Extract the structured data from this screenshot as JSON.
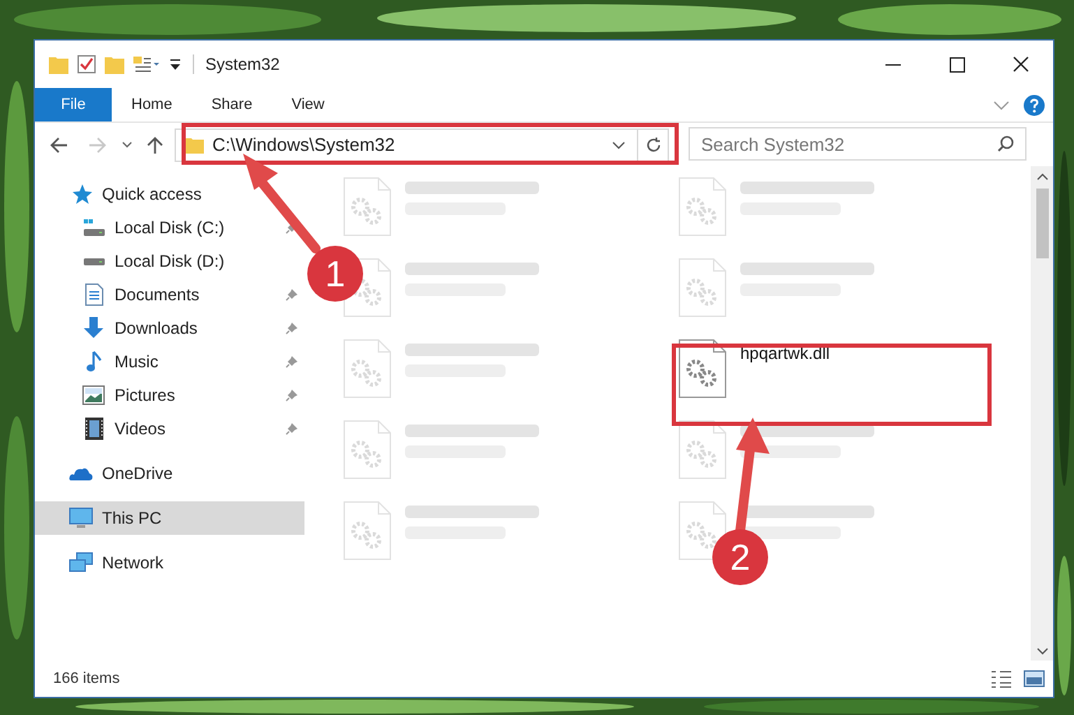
{
  "window": {
    "title": "System32"
  },
  "ribbon_tabs": [
    {
      "label": "File",
      "kind": "file",
      "selected": false
    },
    {
      "label": "Home",
      "kind": "tab",
      "selected": false
    },
    {
      "label": "Share",
      "kind": "tab",
      "selected": false
    },
    {
      "label": "View",
      "kind": "tab",
      "selected": false
    }
  ],
  "address_bar": {
    "value": "C:\\Windows\\System32"
  },
  "search": {
    "placeholder": "Search System32"
  },
  "sidebar": {
    "items": [
      {
        "label": "Quick access",
        "selected": false,
        "children": [
          {
            "label": "Local Disk (C:)",
            "pinned": true
          },
          {
            "label": "Local Disk (D:)",
            "pinned": false
          },
          {
            "label": "Documents",
            "pinned": true
          },
          {
            "label": "Downloads",
            "pinned": true
          },
          {
            "label": "Music",
            "pinned": true
          },
          {
            "label": "Pictures",
            "pinned": true
          },
          {
            "label": "Videos",
            "pinned": true
          }
        ]
      },
      {
        "label": "OneDrive",
        "selected": false
      },
      {
        "label": "This PC",
        "selected": true
      },
      {
        "label": "Network",
        "selected": false
      }
    ]
  },
  "files": [
    {
      "blurred": true
    },
    {
      "blurred": true
    },
    {
      "blurred": true
    },
    {
      "blurred": true
    },
    {
      "blurred": true
    },
    {
      "name": "hpqartwk.dll",
      "blurred": false
    },
    {
      "blurred": true
    },
    {
      "blurred": true
    },
    {
      "blurred": true
    },
    {
      "blurred": true
    }
  ],
  "status_bar": {
    "item_count": "166 items"
  },
  "annotations": [
    {
      "label": "1"
    },
    {
      "label": "2"
    }
  ]
}
